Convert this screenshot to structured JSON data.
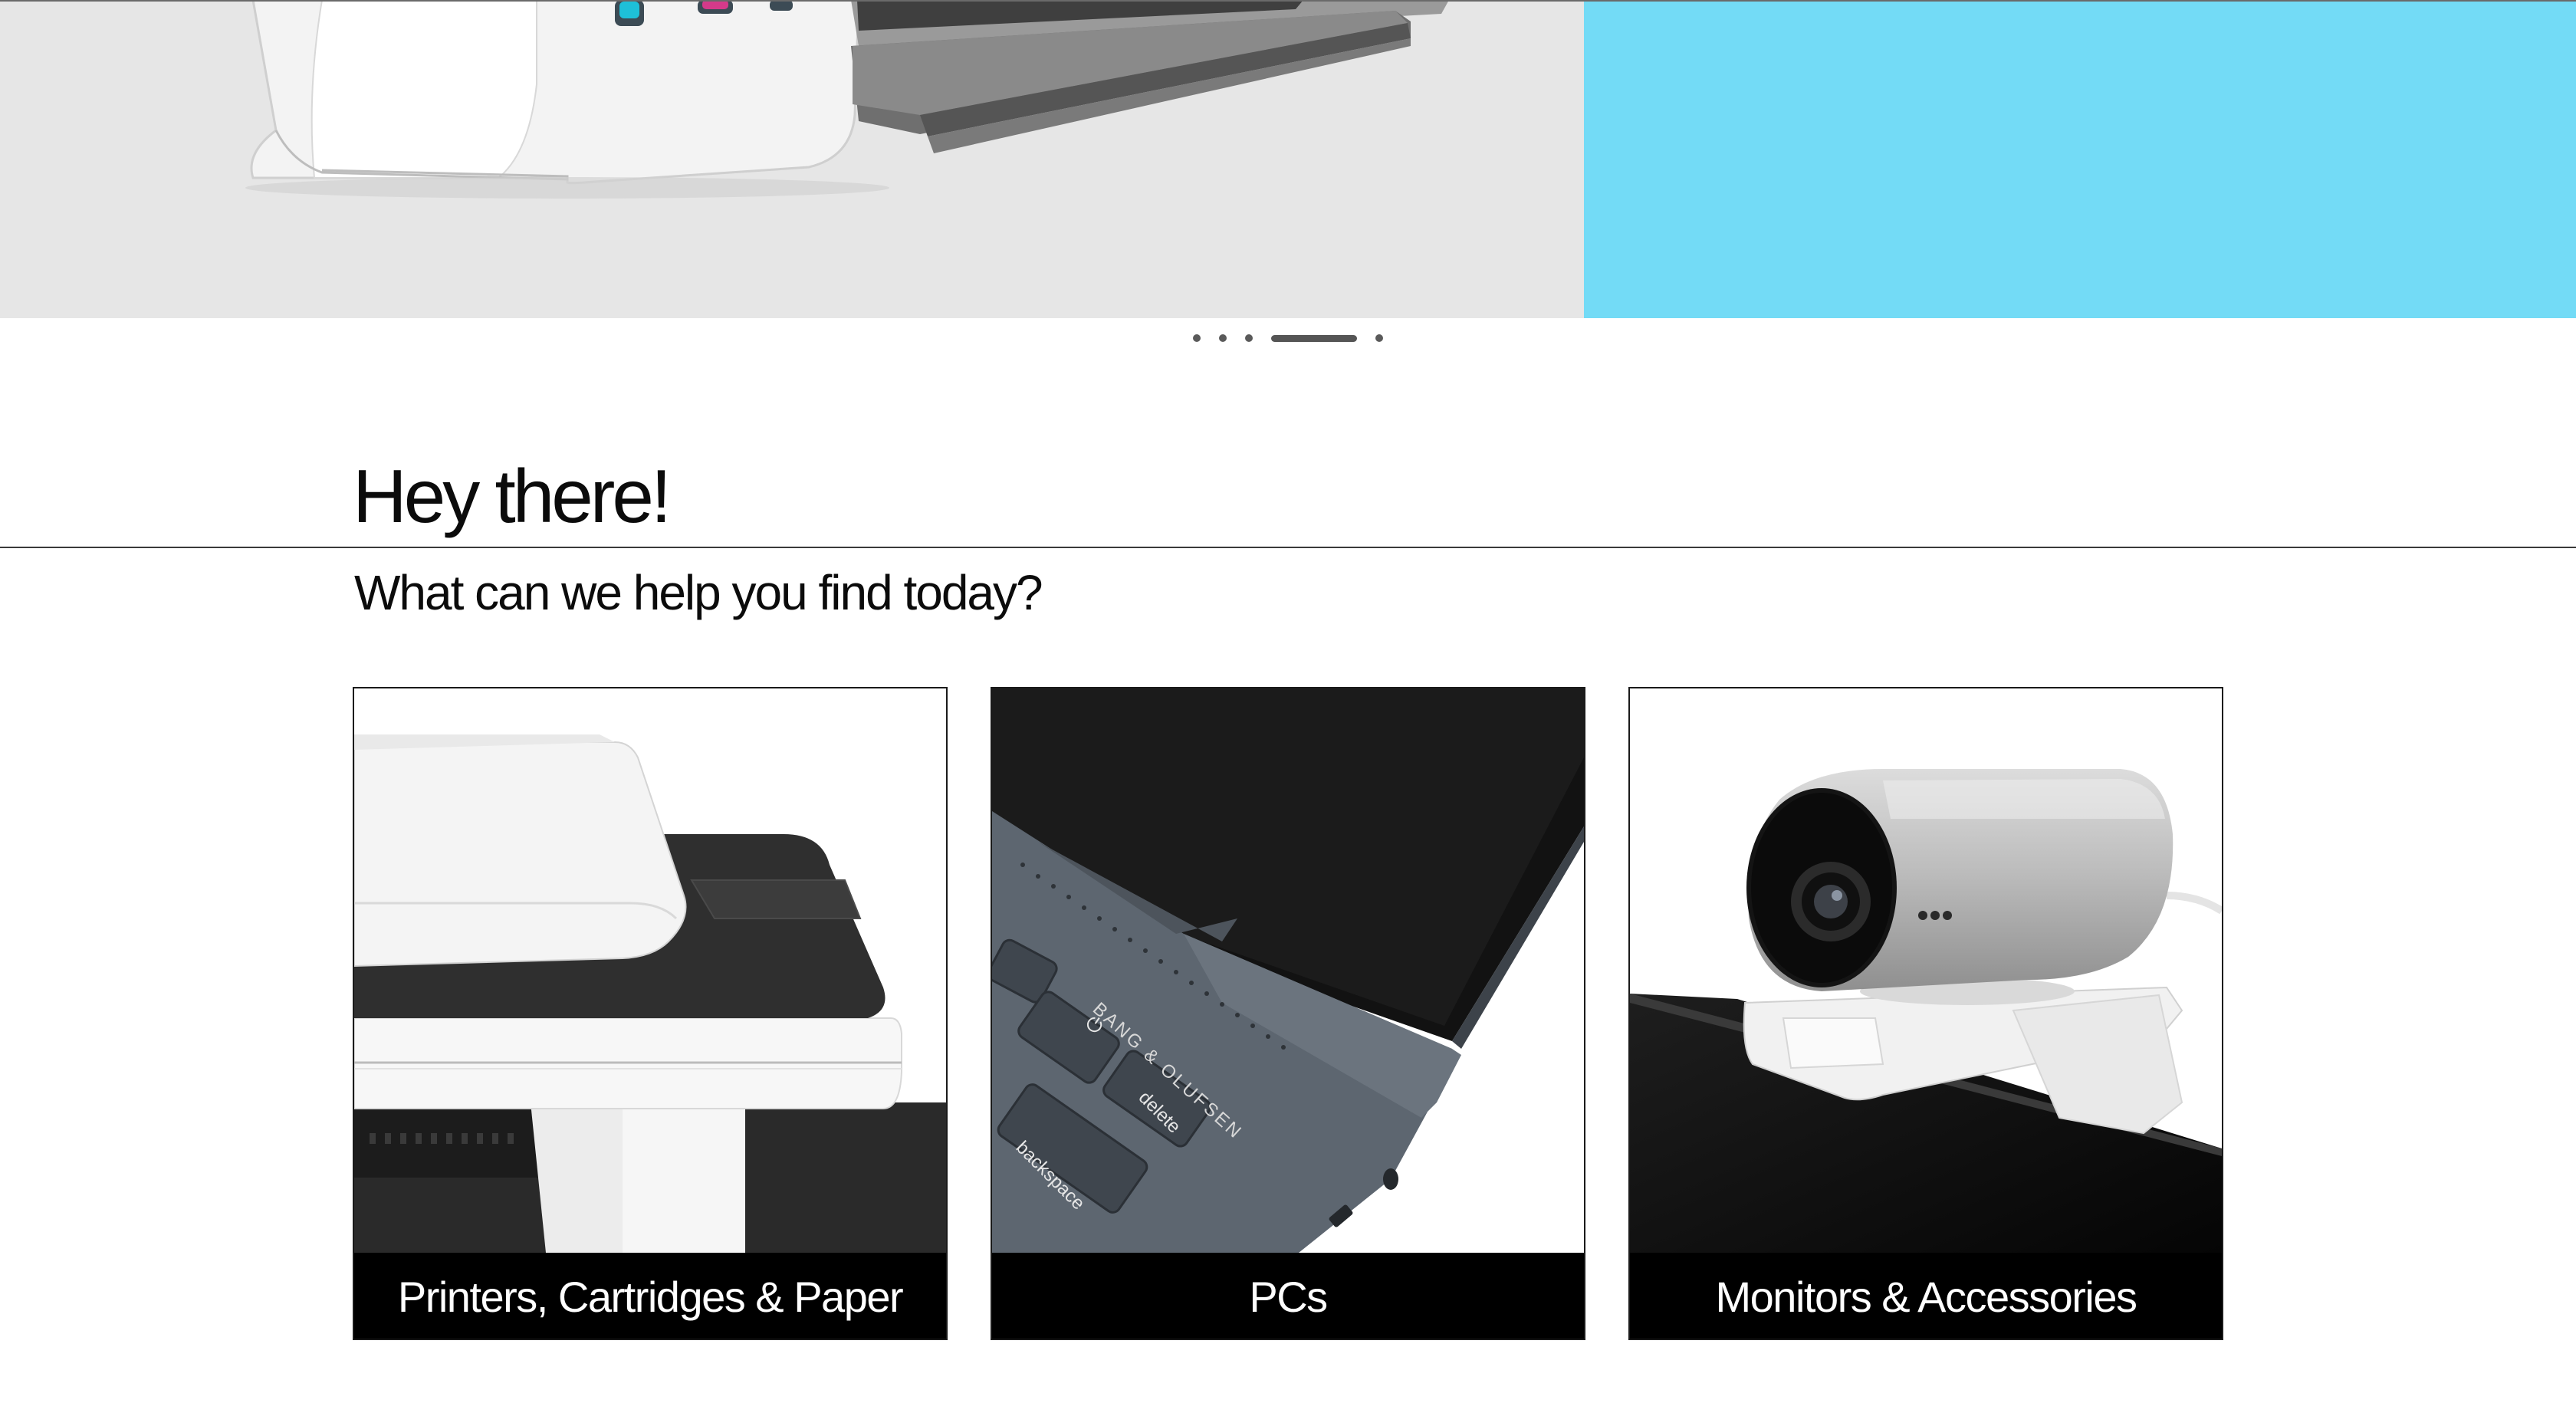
{
  "hero": {
    "colors": {
      "left_panel": "#e6e6e6",
      "right_panel": "#73dbf6"
    },
    "carousel": {
      "slide_count": 5,
      "active_index": 3
    }
  },
  "greeting": {
    "title": "Hey there!",
    "subtitle": "What can we help you find today?"
  },
  "categories": [
    {
      "label": "Printers, Cartridges & Paper",
      "icon": "printer-image"
    },
    {
      "label": "PCs",
      "icon": "laptop-image"
    },
    {
      "label": "Monitors & Accessories",
      "icon": "webcam-image"
    }
  ],
  "pc_image_key_labels": {
    "brand": "BANG & OLUFSEN",
    "key_delete": "delete",
    "key_backspace": "backspace"
  }
}
